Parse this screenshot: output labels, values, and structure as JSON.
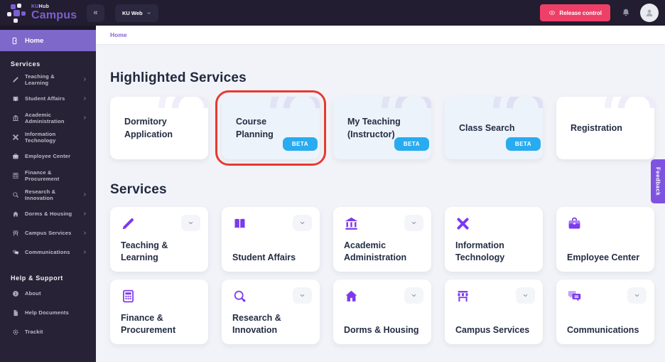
{
  "topbar": {
    "logo": {
      "ku": "KU",
      "hub": "Hub",
      "campus": "Campus"
    },
    "collapse_glyph": "«",
    "workspace": {
      "label": "KU Web",
      "icon": "chevron-down-icon"
    },
    "release_control": {
      "label": "Release control",
      "icon": "eye-icon"
    },
    "bell_icon": "bell-icon",
    "avatar_icon": "user-icon"
  },
  "sidebar": {
    "home": {
      "label": "Home",
      "icon": "door-icon"
    },
    "sections": [
      {
        "header": "Services",
        "items": [
          {
            "label": "Teaching & Learning",
            "icon": "pencil-icon",
            "chevron": true
          },
          {
            "label": "Student Affairs",
            "icon": "book-icon",
            "chevron": true
          },
          {
            "label": "Academic Administration",
            "icon": "bank-icon",
            "chevron": true
          },
          {
            "label": "Information Technology",
            "icon": "tools-x-icon",
            "chevron": false
          },
          {
            "label": "Employee Center",
            "icon": "briefcase-icon",
            "chevron": false
          },
          {
            "label": "Finance & Procurement",
            "icon": "calculator-icon",
            "chevron": false
          },
          {
            "label": "Research & Innovation",
            "icon": "magnifier-icon",
            "chevron": true
          },
          {
            "label": "Dorms & Housing",
            "icon": "house-icon",
            "chevron": true
          },
          {
            "label": "Campus Services",
            "icon": "store-icon",
            "chevron": true
          },
          {
            "label": "Communications",
            "icon": "chat-icon",
            "chevron": true
          }
        ]
      },
      {
        "header": "Help & Support",
        "items": [
          {
            "label": "About",
            "icon": "info-icon",
            "chevron": false
          },
          {
            "label": "Help Documents",
            "icon": "document-icon",
            "chevron": false
          },
          {
            "label": "Trackit",
            "icon": "gear-icon",
            "chevron": false
          }
        ]
      }
    ]
  },
  "breadcrumb": "Home",
  "main": {
    "highlighted": {
      "title": "Highlighted Services",
      "beta_label": "BETA",
      "cards": [
        {
          "title": "Dormitory Application",
          "beta": false,
          "variant": "white",
          "selected": false
        },
        {
          "title": "Course Planning",
          "beta": true,
          "variant": "blue",
          "selected": true
        },
        {
          "title": "My Teaching (Instructor)",
          "beta": true,
          "variant": "blue",
          "selected": false
        },
        {
          "title": "Class Search",
          "beta": true,
          "variant": "blue",
          "selected": false
        },
        {
          "title": "Registration",
          "beta": false,
          "variant": "white",
          "selected": false
        }
      ]
    },
    "services": {
      "title": "Services",
      "cards": [
        {
          "label": "Teaching & Learning",
          "icon": "pencil-icon",
          "chevron": true
        },
        {
          "label": "Student Affairs",
          "icon": "book-icon",
          "chevron": true
        },
        {
          "label": "Academic Administration",
          "icon": "bank-icon",
          "chevron": true
        },
        {
          "label": "Information Technology",
          "icon": "tools-x-icon",
          "chevron": false
        },
        {
          "label": "Employee Center",
          "icon": "briefcase-icon",
          "chevron": false
        },
        {
          "label": "Finance & Procurement",
          "icon": "calculator-icon",
          "chevron": false
        },
        {
          "label": "Research & Innovation",
          "icon": "magnifier-icon",
          "chevron": true
        },
        {
          "label": "Dorms & Housing",
          "icon": "house-icon",
          "chevron": true
        },
        {
          "label": "Campus Services",
          "icon": "store-icon",
          "chevron": true
        },
        {
          "label": "Communications",
          "icon": "chat-icon",
          "chevron": true
        }
      ]
    }
  },
  "feedback_tab": "Feedback",
  "colors": {
    "accent_purple": "#7b5fd2",
    "icon_purple": "#7c3aed",
    "beta_blue": "#29abf0",
    "selection_red": "#e63a2e",
    "release_pink": "#ee3f68",
    "topbar_bg": "#221d30",
    "sidebar_bg": "#272235",
    "main_bg": "#f2f3f8"
  }
}
